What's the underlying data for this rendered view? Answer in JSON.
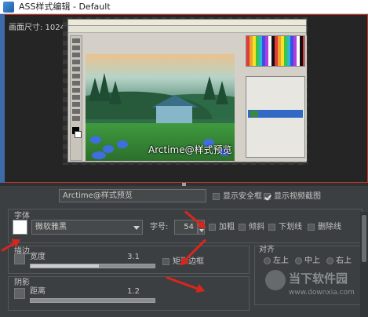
{
  "window": {
    "title": "ASS样式编辑 - Default"
  },
  "preview": {
    "size_label": "画面尺寸: 1024",
    "sample_subtitle": "Arctime@样式预览"
  },
  "toolbar": {
    "sample_text": "Arctime@样式预览",
    "show_safe_frame_label": "显示安全框",
    "show_safe_frame": false,
    "show_video_frame_label": "显示视频截图",
    "show_video_frame": true
  },
  "font": {
    "section_title": "字体",
    "primary_color": "#ffffff",
    "font_name": "微软雅黑",
    "size_label": "字号:",
    "size_value": "54",
    "bold_label": "加粗",
    "italic_label": "倾斜",
    "underline_label": "下划线",
    "strikeout_label": "删除线"
  },
  "outline": {
    "section_title": "描边",
    "width_label": "宽度",
    "width_value": "3.1",
    "width_fraction": 0.55,
    "box_label": "矩形边框"
  },
  "shadow": {
    "section_title": "阴影",
    "distance_label": "距离",
    "distance_value": "1.2"
  },
  "alignment": {
    "section_title": "对齐",
    "options": [
      "左上",
      "中上",
      "右上"
    ]
  },
  "watermark": {
    "main": "当下软件园",
    "url": "www.downxia.com"
  },
  "colors": {
    "accent_arrow": "#d9261c",
    "selection_border": "#c0392b"
  }
}
